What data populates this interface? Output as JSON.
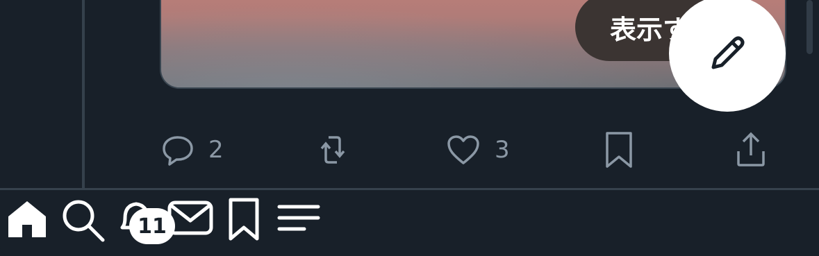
{
  "media": {
    "overlay_label": "表示す"
  },
  "actions": {
    "reply": {
      "icon": "reply-icon",
      "count": "2"
    },
    "repost": {
      "icon": "repost-icon",
      "count": ""
    },
    "like": {
      "icon": "heart-icon",
      "count": "3"
    },
    "bookmark": {
      "icon": "bookmark-icon"
    },
    "share": {
      "icon": "share-icon"
    }
  },
  "compose": {
    "icon": "pencil-icon"
  },
  "tabbar": {
    "items": [
      {
        "icon": "home-icon",
        "active": true
      },
      {
        "icon": "search-icon"
      },
      {
        "icon": "bell-icon",
        "badge": "11"
      },
      {
        "icon": "mail-icon"
      },
      {
        "icon": "bookmark-icon"
      },
      {
        "icon": "menu-icon"
      }
    ]
  },
  "colors": {
    "background": "#182029",
    "icon_muted": "#8b98a5",
    "icon_active": "#ffffff",
    "fab": "#ffffff"
  }
}
